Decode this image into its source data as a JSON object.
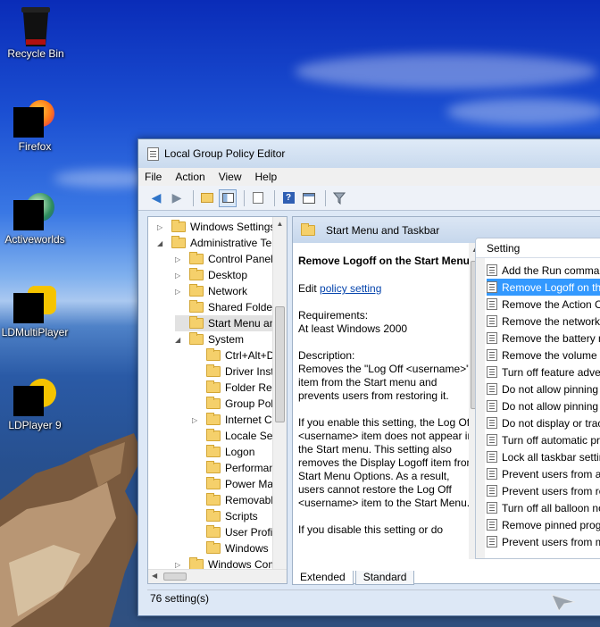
{
  "desktop": {
    "icons": [
      {
        "label": "Recycle Bin",
        "icon": "recycle-bin-icon"
      },
      {
        "label": "Firefox",
        "icon": "firefox-icon"
      },
      {
        "label": "Activeworlds",
        "icon": "activeworlds-icon"
      },
      {
        "label": "LDMultiPlayer",
        "icon": "ldmultiplayer-icon"
      },
      {
        "label": "LDPlayer 9",
        "icon": "ldplayer-icon"
      }
    ]
  },
  "window": {
    "title": "Local Group Policy Editor",
    "menu": [
      "File",
      "Action",
      "View",
      "Help"
    ],
    "toolbar": [
      "back-icon",
      "forward-icon",
      "up-folder-icon",
      "show-hide-tree-icon",
      "export-icon",
      "help-icon",
      "properties-icon",
      "filter-icon"
    ],
    "tree": [
      {
        "label": "Windows Settings",
        "arrow": "▷",
        "level": 1
      },
      {
        "label": "Administrative Templates",
        "arrow": "◢",
        "level": 1
      },
      {
        "label": "Control Panel",
        "arrow": "▷",
        "level": 2
      },
      {
        "label": "Desktop",
        "arrow": "▷",
        "level": 2
      },
      {
        "label": "Network",
        "arrow": "▷",
        "level": 2
      },
      {
        "label": "Shared Folders",
        "arrow": "",
        "level": 2
      },
      {
        "label": "Start Menu and Taskbar",
        "arrow": "",
        "level": 2,
        "selected": true
      },
      {
        "label": "System",
        "arrow": "◢",
        "level": 2
      },
      {
        "label": "Ctrl+Alt+Del Options",
        "arrow": "",
        "level": 3
      },
      {
        "label": "Driver Installation",
        "arrow": "",
        "level": 3
      },
      {
        "label": "Folder Redirection",
        "arrow": "",
        "level": 3
      },
      {
        "label": "Group Policy",
        "arrow": "",
        "level": 3
      },
      {
        "label": "Internet Communication Management",
        "arrow": "▷",
        "level": 3
      },
      {
        "label": "Locale Services",
        "arrow": "",
        "level": 3
      },
      {
        "label": "Logon",
        "arrow": "",
        "level": 3
      },
      {
        "label": "Performance Control Panel",
        "arrow": "",
        "level": 3
      },
      {
        "label": "Power Management",
        "arrow": "",
        "level": 3
      },
      {
        "label": "Removable Storage Access",
        "arrow": "",
        "level": 3
      },
      {
        "label": "Scripts",
        "arrow": "",
        "level": 3
      },
      {
        "label": "User Profiles",
        "arrow": "",
        "level": 3
      },
      {
        "label": "Windows HotStart",
        "arrow": "",
        "level": 3
      },
      {
        "label": "Windows Components",
        "arrow": "▷",
        "level": 2
      }
    ],
    "right_header": "Start Menu and Taskbar",
    "description": {
      "heading": "Remove Logoff on the Start Menu",
      "edit_prefix": "Edit ",
      "edit_link": "policy setting",
      "requirements_label": "Requirements:",
      "requirements": "At least Windows 2000",
      "description_label": "Description:",
      "paragraphs": [
        "Removes the \"Log Off <username>\" item from the Start menu and prevents users from restoring it.",
        "If you enable this setting, the Log Off <username> item does not appear in the Start menu. This setting also removes the Display Logoff item from Start Menu Options. As a result, users cannot restore the Log Off <username> item to the Start Menu.",
        "If you disable this setting or do"
      ]
    },
    "settings_header": "Setting",
    "settings": [
      "Add the Run command to the Start Menu",
      "Remove Logoff on the Start Menu",
      "Remove the Action Center icon",
      "Remove the networking icon",
      "Remove the battery meter",
      "Remove the volume control icon",
      "Turn off feature advertisement balloon notifications",
      "Do not allow pinning Store app to the Taskbar",
      "Do not allow pinning items in Jump Lists",
      "Do not display or track items in Jump Lists from remote locations",
      "Turn off automatic promotion of notification icons to the taskbar",
      "Lock all taskbar settings",
      "Prevent users from adding or removing toolbars",
      "Prevent users from rearranging toolbars",
      "Turn off all balloon notifications",
      "Remove pinned programs from the Taskbar",
      "Prevent users from moving taskbar to another screen dock location"
    ],
    "selected_setting": 1,
    "tabs": [
      "Extended",
      "Standard"
    ],
    "status": "76 setting(s)"
  }
}
